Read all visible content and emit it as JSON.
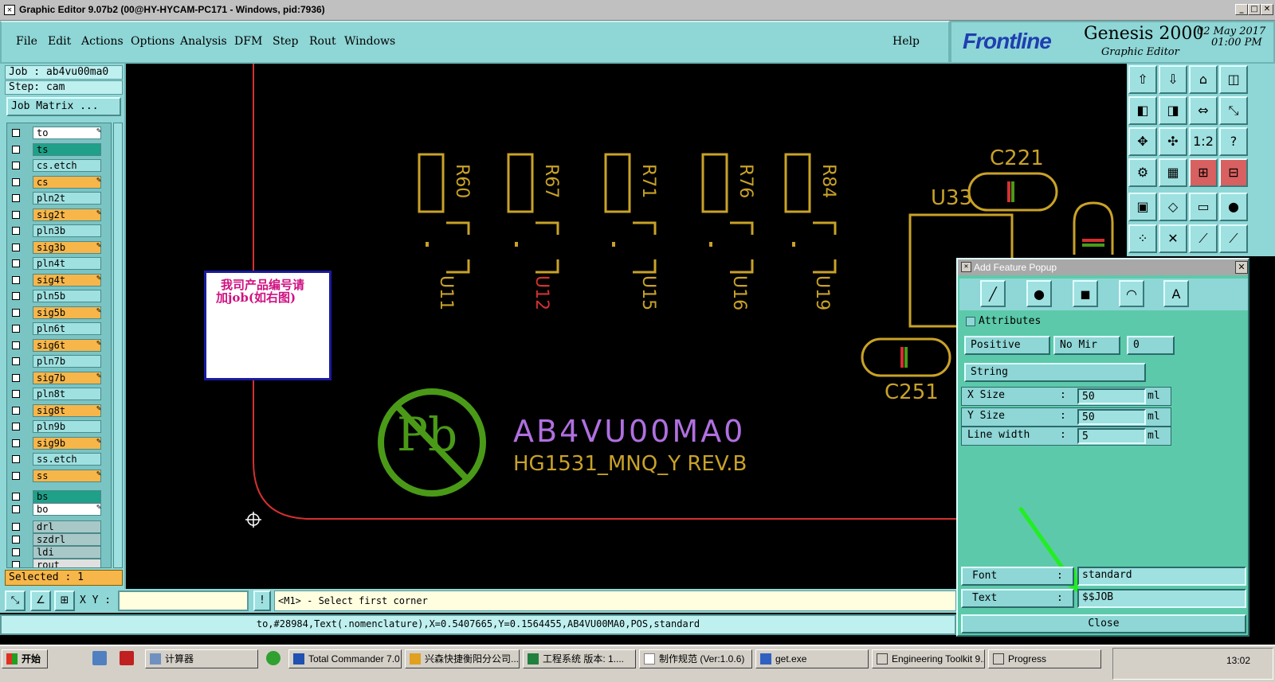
{
  "window": {
    "title": "Graphic Editor 9.07b2 (00@HY-HYCAM-PC171 - Windows, pid:7936)"
  },
  "menu": [
    "File",
    "Edit",
    "Actions",
    "Options",
    "Analysis",
    "DFM",
    "Step",
    "Rout",
    "Windows"
  ],
  "help": "Help",
  "logo": {
    "brand": "Frontline",
    "product": "Genesis 2000",
    "subtitle": "Graphic Editor",
    "date": "02 May 2017",
    "time": "01:00 PM"
  },
  "job": {
    "job_label": "Job : ab4vu00ma0",
    "step_label": "Step: cam",
    "matrix_button": "Job Matrix ..."
  },
  "layers": [
    {
      "name": "to",
      "color": "#ffffff",
      "edit": true
    },
    {
      "name": "ts",
      "color": "#1fa088",
      "edit": false
    },
    {
      "name": "cs.etch",
      "color": "#9fe0e0",
      "edit": false
    },
    {
      "name": "cs",
      "color": "#f7b64a",
      "edit": true
    },
    {
      "name": "pln2t",
      "color": "#9fe0e0",
      "edit": false
    },
    {
      "name": "sig2t",
      "color": "#f7b64a",
      "edit": true
    },
    {
      "name": "pln3b",
      "color": "#9fe0e0",
      "edit": false
    },
    {
      "name": "sig3b",
      "color": "#f7b64a",
      "edit": true
    },
    {
      "name": "pln4t",
      "color": "#9fe0e0",
      "edit": false
    },
    {
      "name": "sig4t",
      "color": "#f7b64a",
      "edit": true
    },
    {
      "name": "pln5b",
      "color": "#9fe0e0",
      "edit": false
    },
    {
      "name": "sig5b",
      "color": "#f7b64a",
      "edit": true
    },
    {
      "name": "pln6t",
      "color": "#9fe0e0",
      "edit": false
    },
    {
      "name": "sig6t",
      "color": "#f7b64a",
      "edit": true
    },
    {
      "name": "pln7b",
      "color": "#9fe0e0",
      "edit": false
    },
    {
      "name": "sig7b",
      "color": "#f7b64a",
      "edit": true
    },
    {
      "name": "pln8t",
      "color": "#9fe0e0",
      "edit": false
    },
    {
      "name": "sig8t",
      "color": "#f7b64a",
      "edit": true
    },
    {
      "name": "pln9b",
      "color": "#9fe0e0",
      "edit": false
    },
    {
      "name": "sig9b",
      "color": "#f7b64a",
      "edit": true
    },
    {
      "name": "ss.etch",
      "color": "#9fe0e0",
      "edit": false
    },
    {
      "name": "ss",
      "color": "#f7b64a",
      "edit": true
    },
    {
      "name": "bs",
      "color": "#1fa088",
      "edit": false
    },
    {
      "name": "bo",
      "color": "#ffffff",
      "edit": true
    },
    {
      "name": "drl",
      "color": "#a8c8c8",
      "edit": false
    },
    {
      "name": "szdrl",
      "color": "#a8c8c8",
      "edit": false
    },
    {
      "name": "ldi",
      "color": "#a8c8c8",
      "edit": false
    },
    {
      "name": "rout",
      "color": "#e0e0e0",
      "edit": false
    }
  ],
  "selected_label": "Selected : 1",
  "canvas": {
    "note_line1": "我司产品编号请",
    "note_line2": "加job(如右图)",
    "part_number": "AB4VU00MA0",
    "part_rev": "HG1531_MNQ_Y REV.B",
    "pb_label": "Pb",
    "resistors": [
      "R60",
      "R67",
      "R71",
      "R76",
      "R84"
    ],
    "ics": [
      "U11",
      "U12",
      "U15",
      "U16",
      "U19"
    ],
    "c221": "C221",
    "u33": "U33",
    "c251": "C251"
  },
  "popup": {
    "title": "Add Feature Popup",
    "attributes": "Attributes",
    "polarity": "Positive",
    "mirror": "No Mir",
    "angle": "0",
    "type": "String",
    "x_size_label": "X Size",
    "x_size": "50",
    "y_size_label": "Y Size",
    "y_size": "50",
    "line_width_label": "Line width",
    "line_width": "5",
    "unit": "ml",
    "colon": ":",
    "font_label": "Font",
    "font_value": "standard",
    "text_label": "Text",
    "text_value": "$$JOB",
    "close": "Close"
  },
  "cmd": {
    "xy_label": "X Y :",
    "xy_value": "",
    "prompt": "<M1> - Select first corner"
  },
  "status": "to,#28984,Text(.nomenclature),X=0.5407665,Y=0.1564455,AB4VU00MA0,POS,standard",
  "taskbar": {
    "start": "开始",
    "items": [
      "计算器",
      "Total Commander 7.0 ...",
      "兴森快捷衡阳分公司...",
      "工程系统  版本: 1....",
      "制作规范 (Ver:1.0.6)",
      "get.exe",
      "Engineering Toolkit 9....",
      "Progress"
    ],
    "clock": "13:02"
  },
  "colors": {
    "panel": "#8fd6d6",
    "accent_orange": "#f7b64a",
    "silk": "#c9a227",
    "purple": "#b070e0",
    "pb_green": "#4a9a18",
    "arrow": "#22ee22"
  }
}
